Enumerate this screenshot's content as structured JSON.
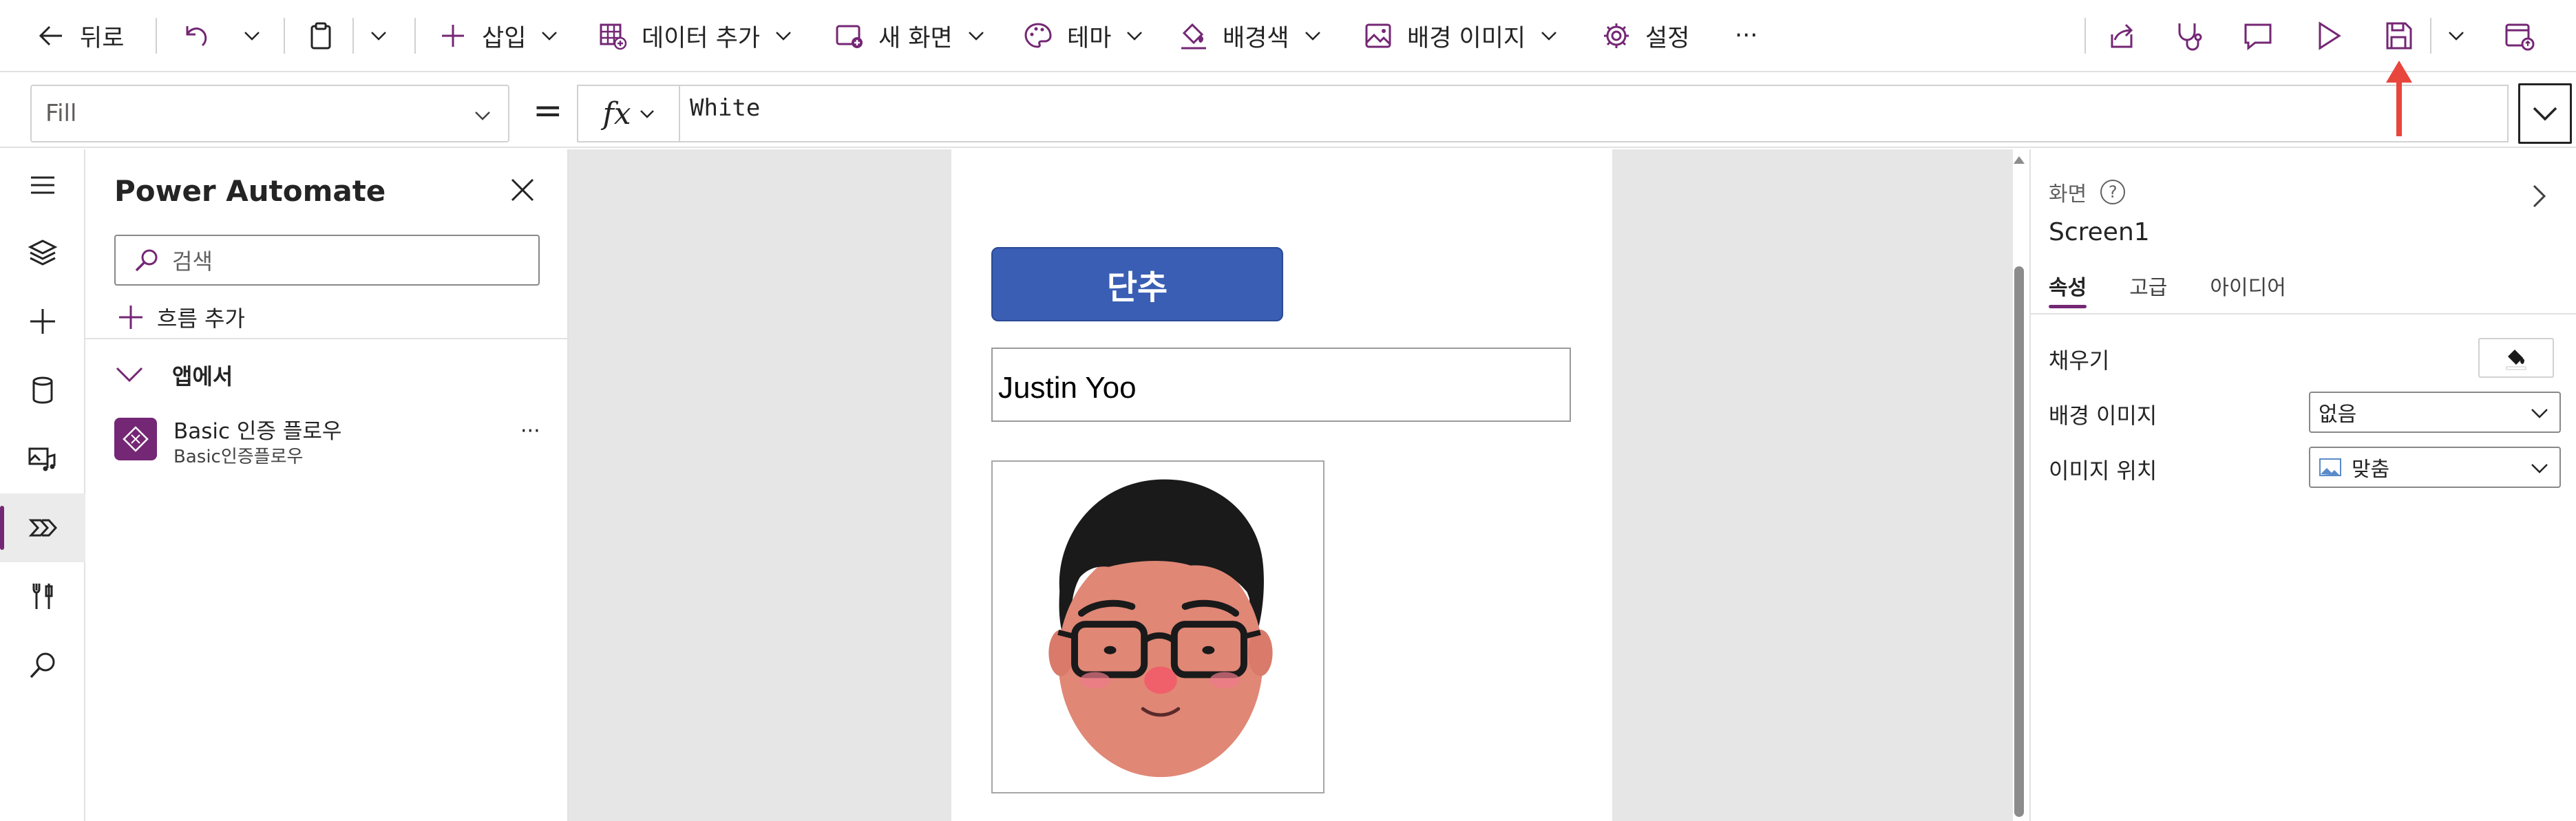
{
  "commandbar": {
    "back_label": "뒤로",
    "insert_label": "삽입",
    "add_data_label": "데이터 추가",
    "new_screen_label": "새 화면",
    "theme_label": "테마",
    "background_color_label": "배경색",
    "background_image_label": "배경 이미지",
    "settings_label": "설정",
    "more_label": "···"
  },
  "formula_bar": {
    "property": "Fill",
    "equals": "=",
    "fx_label": "fx",
    "formula": "White"
  },
  "panel": {
    "title": "Power Automate",
    "search_placeholder": "검색",
    "add_flow_label": "흐름 추가",
    "section_label": "앱에서",
    "flows": [
      {
        "name": "Basic 인증 플로우",
        "subtitle": "Basic인증플로우",
        "more": "···"
      }
    ]
  },
  "canvas": {
    "button_label": "단추",
    "input_value": "Justin Yoo"
  },
  "properties": {
    "type_label": "화면",
    "help": "?",
    "screen_name": "Screen1",
    "tabs": [
      "속성",
      "고급",
      "아이디어"
    ],
    "fill_label": "채우기",
    "background_image_label": "배경 이미지",
    "background_image_value": "없음",
    "image_position_label": "이미지 위치",
    "image_position_value": "맞춤"
  },
  "colors": {
    "accent": "#742774",
    "button_fill": "#3a5eb4",
    "canvas_bg": "#e6e6e6",
    "annotation_arrow": "#e8453c"
  }
}
